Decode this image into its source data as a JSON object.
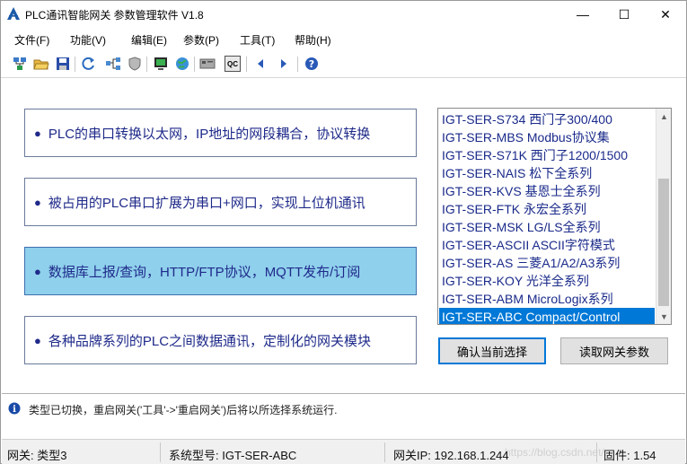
{
  "window": {
    "title": "PLC通讯智能网关 参数管理软件 V1.8",
    "controls": {
      "minimize": "—",
      "maximize": "☐",
      "close": "✕"
    }
  },
  "menu": [
    {
      "label": "文件(F)"
    },
    {
      "label": "功能(V)"
    },
    {
      "label": "编辑(E)"
    },
    {
      "label": "参数(P)"
    },
    {
      "label": "工具(T)"
    },
    {
      "label": "帮助(H)"
    }
  ],
  "toolbar": {
    "icons": [
      "network-config-icon",
      "open-folder-icon",
      "save-icon",
      "refresh-icon",
      "topology-icon",
      "shield-icon",
      "monitor-icon",
      "globe-icon",
      "device-icon",
      "qc-icon",
      "arrow-left-icon",
      "arrow-right-icon",
      "help-icon"
    ],
    "qc_label": "QC"
  },
  "features": [
    {
      "label": "PLC的串口转换以太网，IP地址的网段耦合，协议转换",
      "selected": false
    },
    {
      "label": "被占用的PLC串口扩展为串口+网口，实现上位机通讯",
      "selected": false
    },
    {
      "label": "数据库上报/查询，HTTP/FTP协议，MQTT发布/订阅",
      "selected": true
    },
    {
      "label": "各种品牌系列的PLC之间数据通讯，定制化的网关模块",
      "selected": false
    }
  ],
  "feature_bullet": "●",
  "system_list": {
    "items": [
      "IGT-SER-S734  西门子300/400",
      "IGT-SER-MBS  Modbus协议集",
      "IGT-SER-S71K  西门子1200/1500",
      "IGT-SER-NAIS  松下全系列",
      "IGT-SER-KVS  基恩士全系列",
      "IGT-SER-FTK  永宏全系列",
      "IGT-SER-MSK  LG/LS全系列",
      "IGT-SER-ASCII  ASCII字符模式",
      "IGT-SER-AS  三菱A1/A2/A3系列",
      "IGT-SER-KOY  光洋全系列",
      "IGT-SER-ABM  MicroLogix系列",
      "IGT-SER-ABC  Compact/Control"
    ],
    "selected_index": 11,
    "scroll_up": "▲",
    "scroll_down": "▼"
  },
  "buttons": {
    "confirm": "确认当前选择",
    "read_params": "读取网关参数"
  },
  "info": {
    "icon_glyph": "i",
    "message": "类型已切换，重启网关('工具'->'重启网关')后将以所选择系统运行."
  },
  "status": {
    "gateway": "网关:  类型3",
    "system_model": "系统型号:  IGT-SER-ABC",
    "gateway_ip": "网关IP:  192.168.1.244",
    "firmware": "固件:  1.54",
    "watermark": "https://blog.csdn.net/..."
  },
  "colors": {
    "feature_text": "#1f2a8a",
    "feature_selected_bg": "#8fd0ec",
    "list_selected_bg": "#0078d7",
    "default_button_border": "#0078d7"
  }
}
